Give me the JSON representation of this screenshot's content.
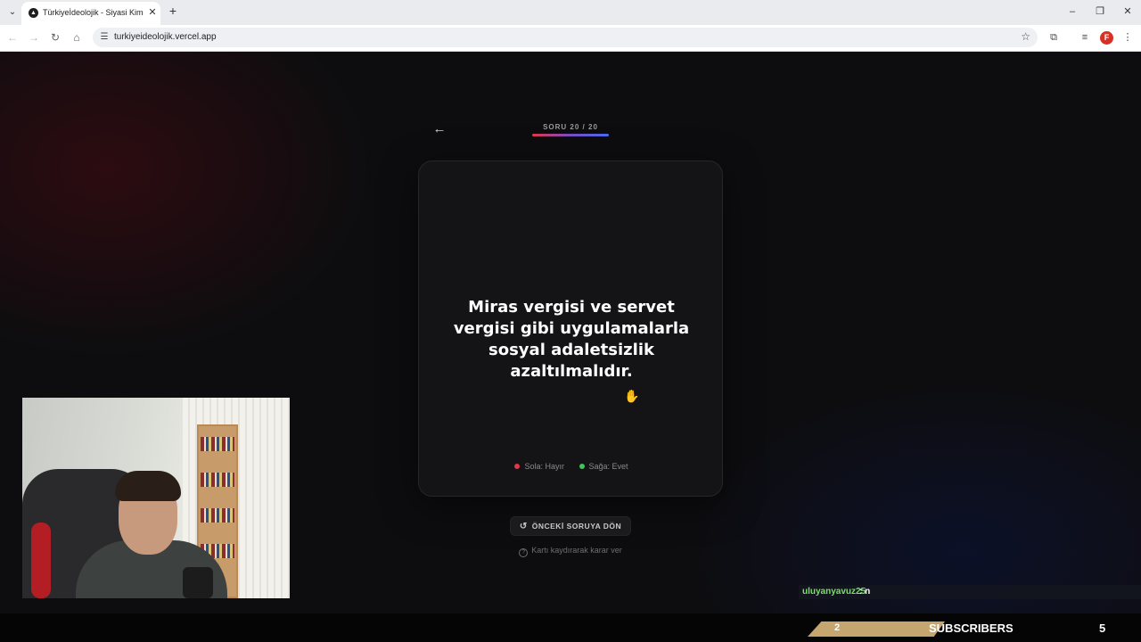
{
  "browser": {
    "tab": {
      "title": "Türkiyeİdeolojik - Siyasi Kimliğ",
      "favicon_icon": "triangle-logo-icon",
      "close_glyph": "✕"
    },
    "new_tab_glyph": "+",
    "tab_menu_glyph": "⌄",
    "window_controls": {
      "minimize": "–",
      "restore": "❐",
      "close": "✕"
    },
    "nav": {
      "back": "←",
      "forward": "→",
      "reload": "↻",
      "home": "⌂"
    },
    "address": {
      "url": "turkiyeideolojik.vercel.app",
      "site_info_glyph": "☰",
      "bookmark_glyph": "☆"
    },
    "toolbar_icons": {
      "extensions": "⧉",
      "media": "≡",
      "profile_letter": "F",
      "menu": "⋮"
    }
  },
  "quiz": {
    "back_glyph": "←",
    "progress": {
      "label": "SORU 20 / 20",
      "current": 20,
      "total": 20,
      "fraction": 1.0
    },
    "question": "Miras vergisi ve servet vergisi gibi uygulamalarla sosyal adaletsizlik azaltılmalıdır.",
    "hints": {
      "left": "Sola: Hayır",
      "right": "Sağa: Evet"
    },
    "colors": {
      "no": "#e3364a",
      "yes": "#3cc65a",
      "accent_start": "#e3364a",
      "accent_end": "#4a6cf0"
    },
    "previous_button": {
      "label": "ÖNCEKİ SORUYA DÖN",
      "icon_glyph": "↺"
    },
    "swipe_hint": {
      "text": "Kartı kaydırarak karar ver",
      "icon_glyph": "?"
    },
    "cursor_glyph": "✋"
  },
  "stream": {
    "chat": {
      "username": "uluyanyavuz25",
      "message": ": n"
    },
    "subscribers": {
      "left_count": "2",
      "label": "SUBSCRIBERS",
      "right_count": "5",
      "accent": "#c5a66f"
    }
  }
}
